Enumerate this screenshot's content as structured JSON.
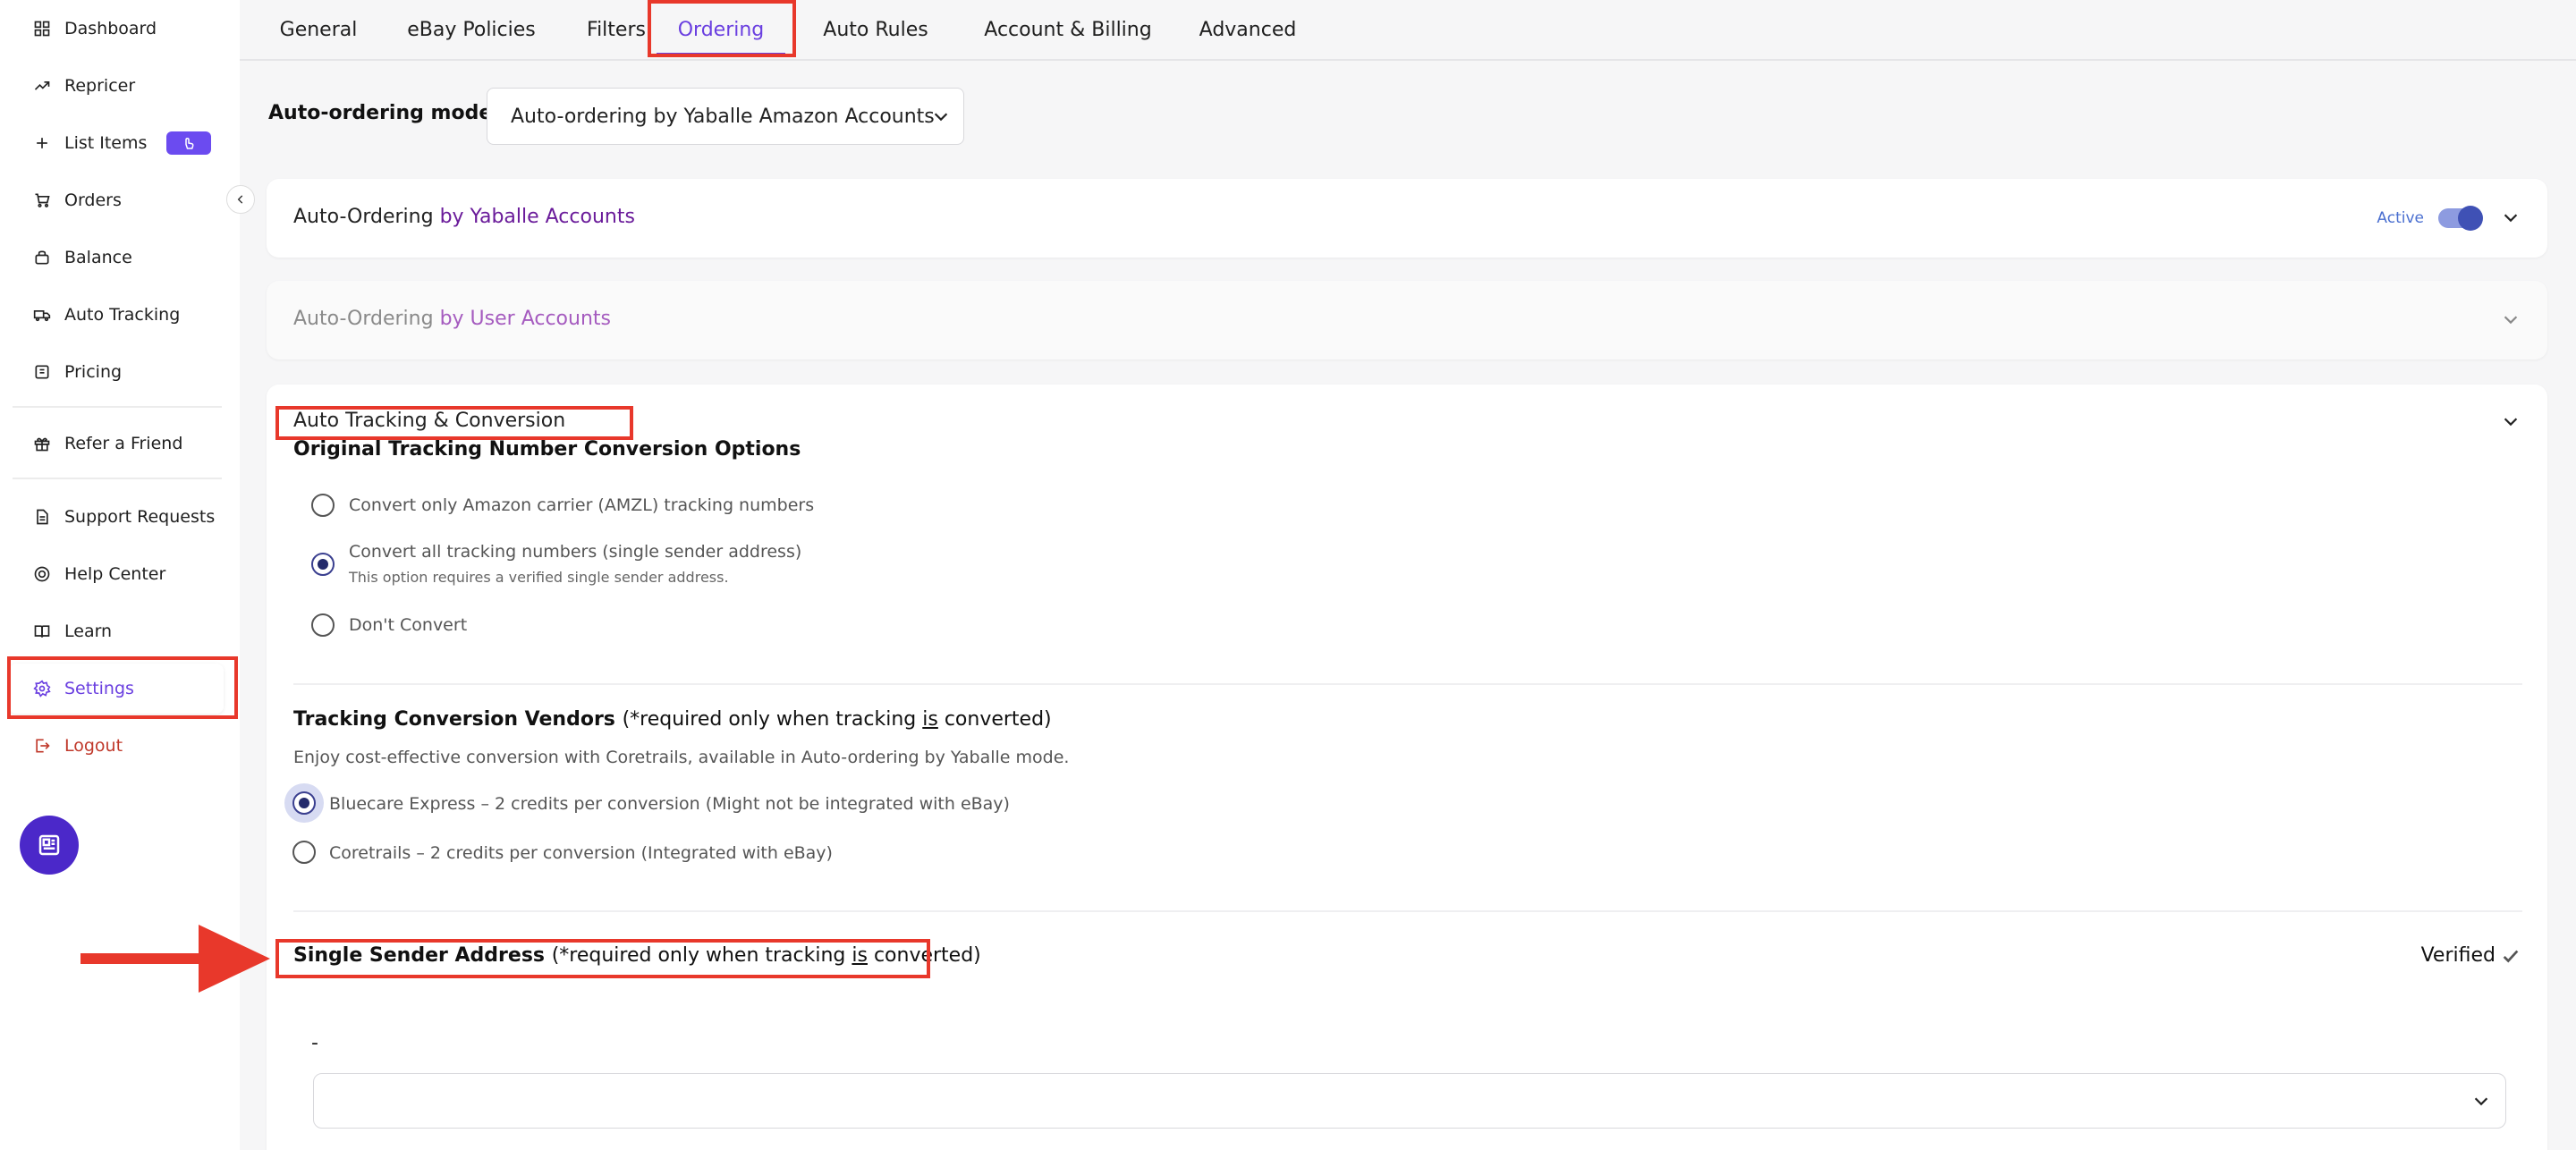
{
  "sidebar": {
    "items": [
      {
        "label": "Dashboard",
        "icon": "dashboard-icon"
      },
      {
        "label": "Repricer",
        "icon": "trend-icon"
      },
      {
        "label": "List Items",
        "icon": "plus-icon"
      },
      {
        "label": "Orders",
        "icon": "cart-icon"
      },
      {
        "label": "Balance",
        "icon": "wallet-icon"
      },
      {
        "label": "Auto Tracking",
        "icon": "truck-icon"
      },
      {
        "label": "Pricing",
        "icon": "pricing-icon"
      },
      {
        "label": "Refer a Friend",
        "icon": "gift-icon"
      },
      {
        "label": "Support Requests",
        "icon": "document-icon"
      },
      {
        "label": "Help Center",
        "icon": "lifebuoy-icon"
      },
      {
        "label": "Learn",
        "icon": "book-icon"
      },
      {
        "label": "Settings",
        "icon": "gear-icon"
      },
      {
        "label": "Logout",
        "icon": "logout-icon"
      }
    ],
    "active": "Settings"
  },
  "tabs": {
    "items": [
      "General",
      "eBay Policies",
      "Filters",
      "Ordering",
      "Auto Rules",
      "Account & Billing",
      "Advanced"
    ],
    "active": "Ordering"
  },
  "mode": {
    "label": "Auto-ordering mode",
    "value": "Auto-ordering by Yaballe Amazon Accounts"
  },
  "cards": {
    "yaballe": {
      "prefix": "Auto-Ordering",
      "highlight": "by Yaballe Accounts",
      "status": "Active"
    },
    "user": {
      "prefix": "Auto-Ordering",
      "highlight": "by User Accounts"
    },
    "tracking": {
      "title": "Auto Tracking & Conversion",
      "conversion": {
        "title": "Original Tracking Number Conversion Options",
        "options": [
          {
            "label": "Convert only Amazon carrier (AMZL) tracking numbers",
            "sub": ""
          },
          {
            "label": "Convert all tracking numbers (single sender address)",
            "sub": "This option requires a verified single sender address."
          },
          {
            "label": "Don't Convert",
            "sub": ""
          }
        ],
        "selected": 1
      },
      "vendors": {
        "title": "Tracking Conversion Vendors",
        "note_pre": "(*required only when tracking ",
        "note_u": "is",
        "note_post": " converted)",
        "description": "Enjoy cost-effective conversion with Coretrails, available in Auto-ordering by Yaballe mode.",
        "options": [
          "Bluecare Express – 2 credits per conversion (Might not be integrated with eBay)",
          "Coretrails – 2 credits per conversion (Integrated with eBay)"
        ],
        "selected": 0
      },
      "sender": {
        "title": "Single Sender Address",
        "note_pre": "(*required only when tracking ",
        "note_u": "is",
        "note_post": " converted)",
        "status": "Verified",
        "field_label": "-",
        "field_value": ""
      }
    }
  },
  "colors": {
    "accent": "#6a3fe0",
    "annotation": "#e8382b",
    "logout": "#c0392b",
    "toggle": "#3f51b5"
  }
}
